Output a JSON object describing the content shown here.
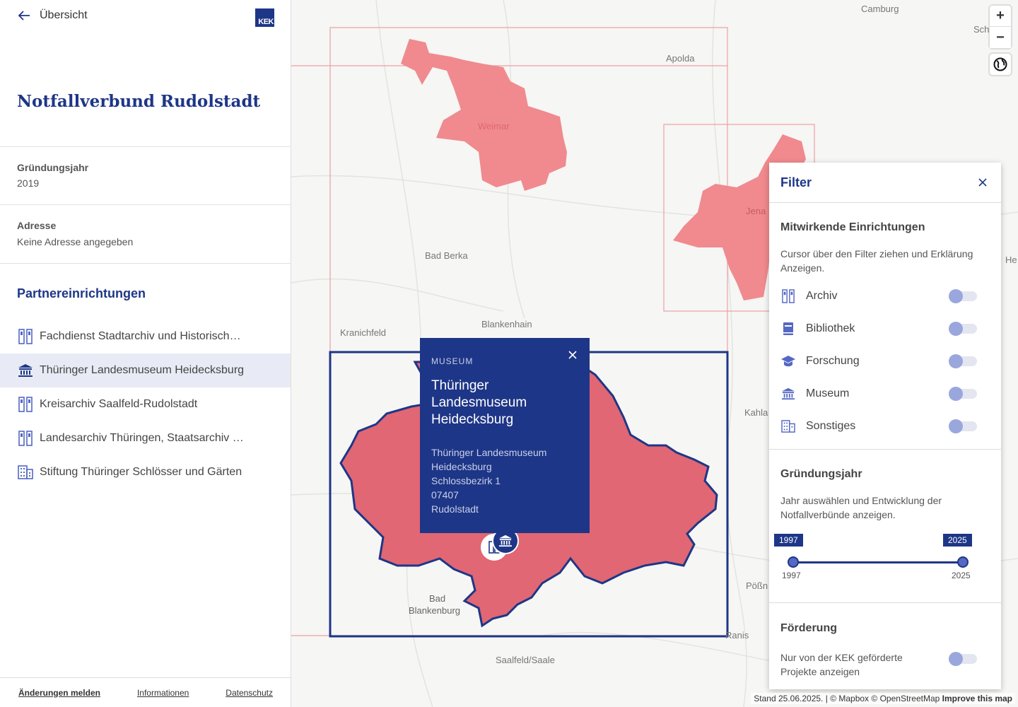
{
  "sidebar": {
    "back_label": "Übersicht",
    "logo_text": "KEK",
    "title": "Notfallverbund Rudolstadt",
    "founding": {
      "label": "Gründungsjahr",
      "value": "2019"
    },
    "address": {
      "label": "Adresse",
      "value": "Keine Adresse angegeben"
    },
    "partners_title": "Partnereinrichtungen",
    "partners": [
      {
        "label": "Fachdienst Stadtarchiv und Historisches Archiv",
        "icon": "archive-icon",
        "active": false
      },
      {
        "label": "Thüringer Landesmuseum Heidecksburg",
        "icon": "museum-icon",
        "active": true
      },
      {
        "label": "Kreisarchiv Saalfeld-Rudolstadt",
        "icon": "archive-icon",
        "active": false
      },
      {
        "label": "Landesarchiv Thüringen, Staatsarchiv Rudolstadt",
        "icon": "archive-icon",
        "active": false
      },
      {
        "label": "Stiftung Thüringer Schlösser und Gärten",
        "icon": "building-icon",
        "active": false
      }
    ],
    "footer": {
      "report": "Änderungen melden",
      "info": "Informationen",
      "privacy": "Datenschutz"
    }
  },
  "map": {
    "places": {
      "camburg": "Camburg",
      "sch": "Sch",
      "apolda": "Apolda",
      "weimar": "Weimar",
      "jena": "Jena",
      "bad_berka": "Bad Berka",
      "blankenhain": "Blankenhain",
      "kranichfeld": "Kranichfeld",
      "kahla": "Kahla",
      "poessneck": "Pößn",
      "bad": "Bad",
      "blankenburg": "Blankenburg",
      "ranis": "Ranis",
      "saalfeld": "Saalfeld/Saale",
      "he": "He"
    },
    "controls": {
      "zoom_in": "+",
      "zoom_out": "−"
    },
    "attribution": {
      "stand": "Stand 25.06.2025. |",
      "mapbox": "© Mapbox",
      "osm": "© OpenStreetMap",
      "improve": "Improve this map"
    },
    "colors": {
      "region": "#f08a8e",
      "selected_region": "#e06773",
      "accent": "#1e3687"
    }
  },
  "popup": {
    "category": "MUSEUM",
    "name": "Thüringer Landesmuseum Heidecksburg",
    "address_lines": [
      "Thüringer Landesmuseum",
      "Heidecksburg",
      "Schlossbezirk 1",
      "07407",
      "Rudolstadt"
    ]
  },
  "filter": {
    "title": "Filter",
    "contributors": {
      "title": "Mitwirkende Einrichtungen",
      "desc": "Cursor über den Filter ziehen und Erklärung Anzeigen.",
      "items": [
        {
          "label": "Archiv",
          "icon": "archive-icon",
          "on": false
        },
        {
          "label": "Bibliothek",
          "icon": "book-icon",
          "on": false
        },
        {
          "label": "Forschung",
          "icon": "graduation-cap-icon",
          "on": false
        },
        {
          "label": "Museum",
          "icon": "museum-icon",
          "on": false
        },
        {
          "label": "Sonstiges",
          "icon": "building-icon",
          "on": false
        }
      ]
    },
    "founding": {
      "title": "Gründungsjahr",
      "desc": "Jahr auswählen und Entwicklung der Notfallverbünde anzeigen.",
      "min": "1997",
      "max": "2025",
      "from": "1997",
      "to": "2025"
    },
    "funding": {
      "title": "Förderung",
      "desc": "Nur von der KEK geförderte Projekte anzeigen",
      "on": false
    }
  }
}
